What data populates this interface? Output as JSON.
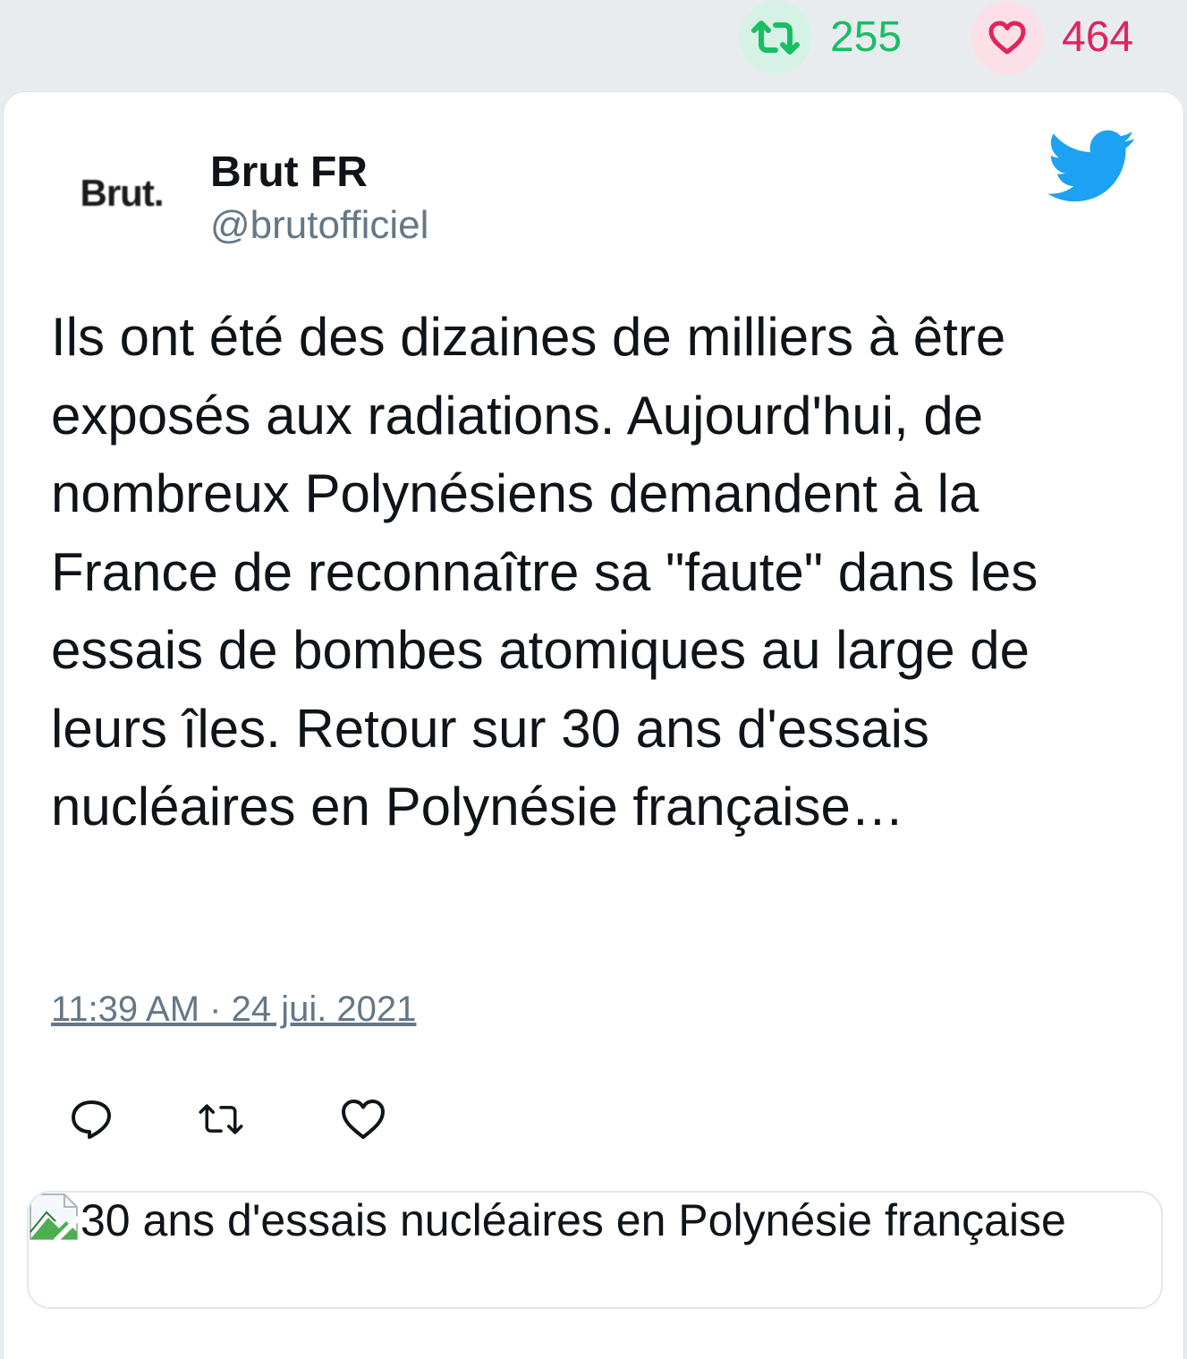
{
  "stats": {
    "retweets": "255",
    "likes": "464"
  },
  "author": {
    "avatar_text": "Brut.",
    "name": "Brut FR",
    "handle": "@brutofficiel"
  },
  "tweet": {
    "text": "Ils ont été des dizaines de milliers à être exposés aux radiations. Aujourd'hui, de nombreux Polynésiens demandent à la France de reconnaître sa \"faute\" dans les essais de bombes atomiques au large de leurs îles. Retour sur 30 ans d'essais nucléaires en Polynésie française…",
    "timestamp": "11:39 AM · 24 jui. 2021"
  },
  "link_card": {
    "alt_text": "30 ans d'essais nucléaires en Polynésie française"
  },
  "colors": {
    "retweet_green": "#17bf63",
    "like_red": "#e0245e",
    "twitter_blue": "#1da1f2",
    "secondary_text": "#657786"
  },
  "icons": {
    "retweet": "retweet-icon",
    "like": "heart-icon",
    "reply": "reply-icon",
    "logo": "twitter-bird-icon",
    "broken_image": "broken-image-icon"
  }
}
